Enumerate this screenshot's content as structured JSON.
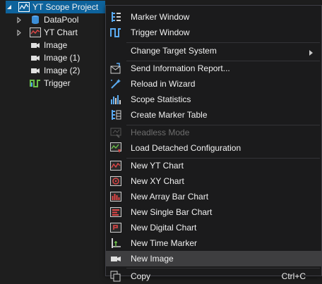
{
  "tree": {
    "items": [
      {
        "label": "YT Scope Project",
        "icon": "scope-project-icon"
      },
      {
        "label": "DataPool",
        "icon": "datapool-icon"
      },
      {
        "label": "YT Chart",
        "icon": "yt-chart-icon"
      },
      {
        "label": "Image",
        "icon": "camera-icon"
      },
      {
        "label": "Image (1)",
        "icon": "camera-icon"
      },
      {
        "label": "Image (2)",
        "icon": "camera-icon"
      },
      {
        "label": "Trigger",
        "icon": "trigger-icon"
      }
    ]
  },
  "context_menu": {
    "items": [
      {
        "label": "Marker Window",
        "icon": "marker-window-icon"
      },
      {
        "label": "Trigger Window",
        "icon": "trigger-window-icon"
      },
      {
        "label": "Change Target System",
        "icon": "",
        "submenu": true
      },
      {
        "label": "Send Information Report...",
        "icon": "mail-report-icon"
      },
      {
        "label": "Reload in Wizard",
        "icon": "wizard-icon"
      },
      {
        "label": "Scope Statistics",
        "icon": "statistics-icon"
      },
      {
        "label": "Create Marker Table",
        "icon": "marker-table-icon"
      },
      {
        "label": "Headless Mode",
        "icon": "headless-icon",
        "disabled": true
      },
      {
        "label": "Load Detached Configuration",
        "icon": "load-config-icon"
      },
      {
        "label": "New YT Chart",
        "icon": "yt-chart-icon"
      },
      {
        "label": "New XY Chart",
        "icon": "xy-chart-icon"
      },
      {
        "label": "New Array Bar Chart",
        "icon": "array-bar-chart-icon"
      },
      {
        "label": "New Single Bar Chart",
        "icon": "single-bar-chart-icon"
      },
      {
        "label": "New Digital Chart",
        "icon": "digital-chart-icon"
      },
      {
        "label": "New Time Marker",
        "icon": "time-marker-icon"
      },
      {
        "label": "New Image",
        "icon": "camera-icon",
        "highlighted": true
      },
      {
        "label": "Copy",
        "icon": "copy-icon",
        "shortcut": "Ctrl+C"
      }
    ]
  },
  "colors": {
    "background": "#1e1e1e",
    "selection": "#0e639c",
    "menu_background": "#1b1b1c",
    "menu_hover": "#3e3e40",
    "text": "#f1f1f1",
    "disabled_text": "#6d6d6d"
  }
}
